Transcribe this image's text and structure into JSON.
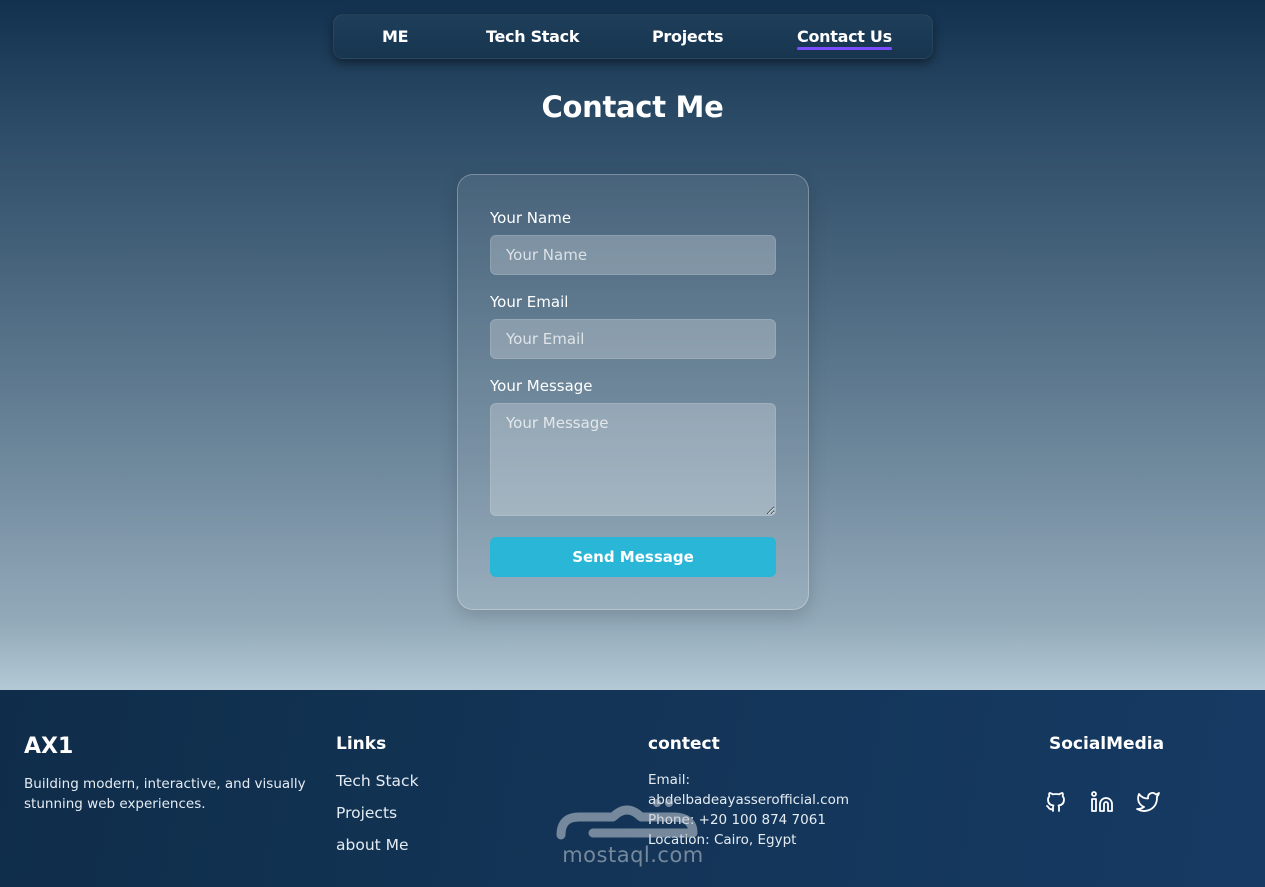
{
  "nav": {
    "items": [
      {
        "label": "ME"
      },
      {
        "label": "Tech Stack"
      },
      {
        "label": "Projects"
      },
      {
        "label": "Contact Us",
        "active": true
      }
    ],
    "accent_color": "#7b4dff"
  },
  "page_title": "Contact Me",
  "form": {
    "name_label": "Your Name",
    "name_placeholder": "Your Name",
    "email_label": "Your Email",
    "email_placeholder": "Your Email",
    "message_label": "Your Message",
    "message_placeholder": "Your Message",
    "submit_label": "Send Message",
    "submit_color": "#2ab6d6"
  },
  "footer": {
    "brand": "AX1",
    "tagline": "Building modern, interactive, and visually stunning web experiences.",
    "links_heading": "Links",
    "links": [
      "Tech Stack",
      "Projects",
      "about Me"
    ],
    "contact_heading": "contect",
    "contact": {
      "email_label": "Email:",
      "email": "abdelbadeayasserofficial.com",
      "phone": "Phone: +20 100 874 7061",
      "location": "Location: Cairo, Egypt"
    },
    "social_heading": "SocialMedia",
    "social_icons": [
      "github-icon",
      "linkedin-icon",
      "twitter-icon"
    ]
  },
  "watermark": {
    "text": "mostaql.com"
  }
}
